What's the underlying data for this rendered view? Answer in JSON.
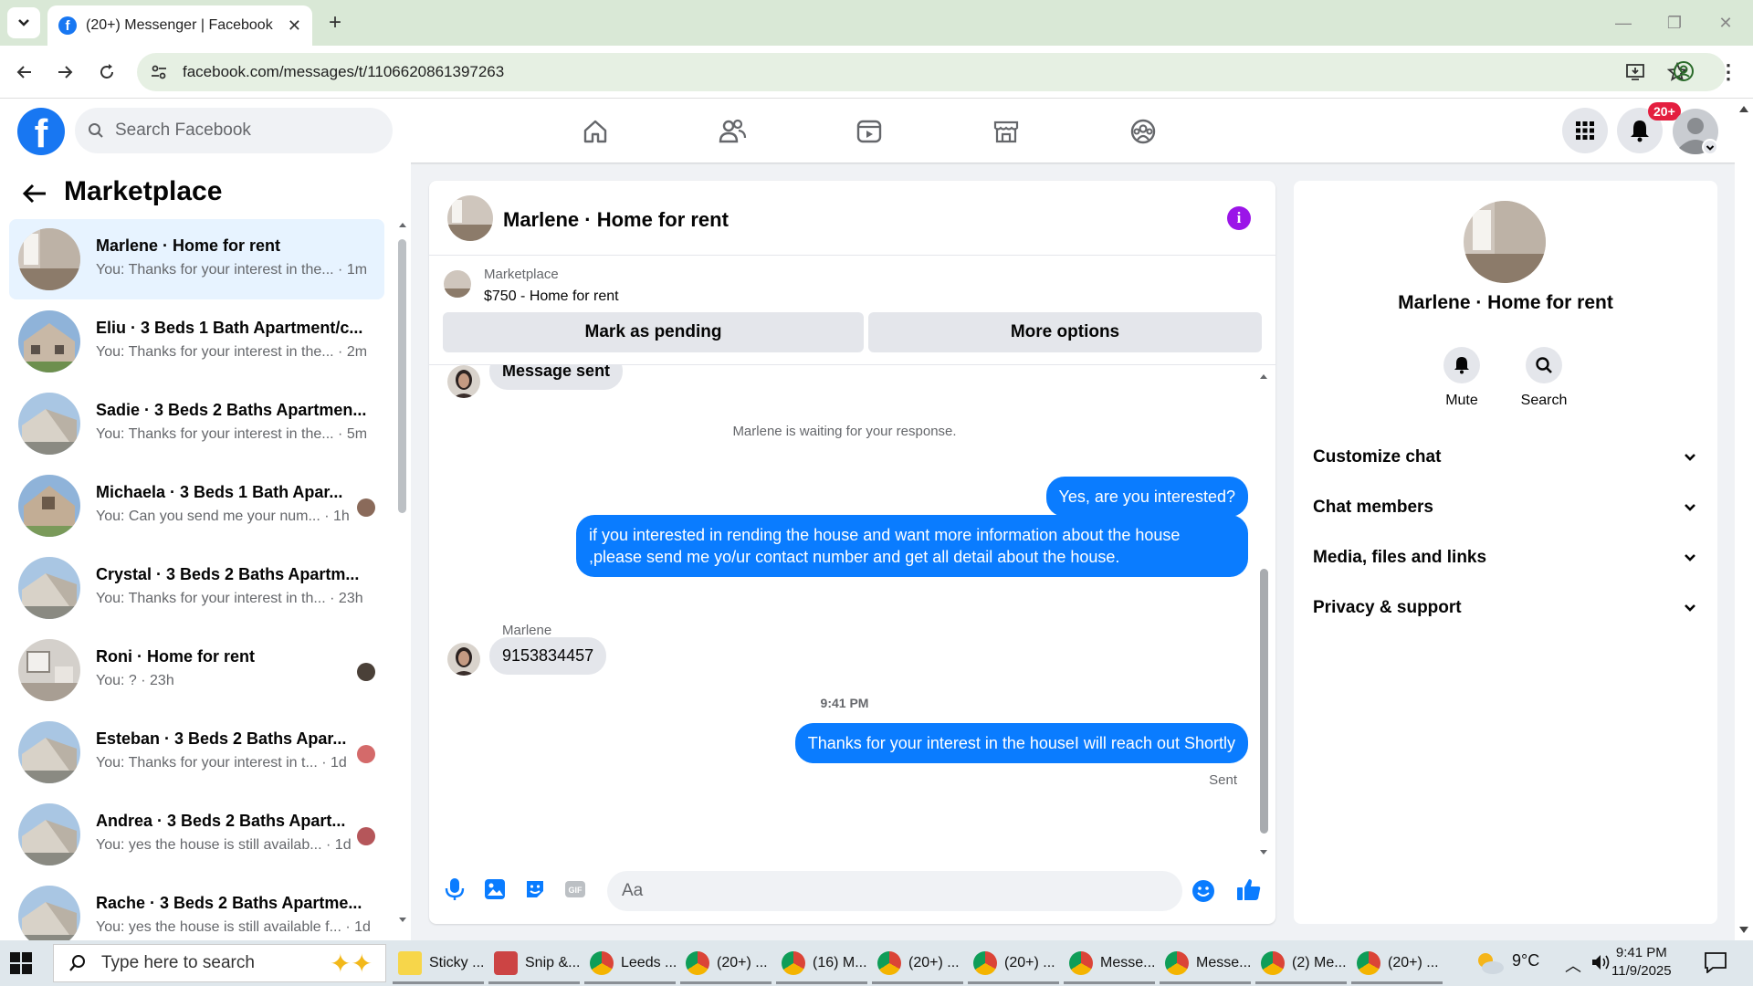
{
  "browser": {
    "tab_title": "(20+) Messenger | Facebook",
    "url": "facebook.com/messages/t/1106620861397263"
  },
  "header": {
    "search_placeholder": "Search Facebook",
    "notification_badge": "20+"
  },
  "left": {
    "title": "Marketplace",
    "conversations": [
      {
        "name": "Marlene · Home for rent",
        "preview": "You: Thanks for your interest in the...",
        "time": "· 1m"
      },
      {
        "name": "Eliu · 3 Beds 1 Bath Apartment/c...",
        "preview": "You: Thanks for your interest in the...",
        "time": "· 2m"
      },
      {
        "name": "Sadie · 3 Beds 2 Baths Apartmen...",
        "preview": "You: Thanks for your interest in the...",
        "time": "· 5m"
      },
      {
        "name": "Michaela · 3 Beds 1 Bath Apar...",
        "preview": "You: Can you send me your num...",
        "time": "· 1h"
      },
      {
        "name": "Crystal · 3 Beds 2 Baths Apartm...",
        "preview": "You: Thanks for your interest in th...",
        "time": "· 23h"
      },
      {
        "name": "Roni · Home for rent",
        "preview": "You: ?",
        "time": "· 23h"
      },
      {
        "name": "Esteban · 3 Beds 2 Baths Apar...",
        "preview": "You: Thanks for your interest in t...",
        "time": "· 1d"
      },
      {
        "name": "Andrea · 3 Beds 2 Baths Apart...",
        "preview": "You: yes the house is still availab...",
        "time": "· 1d"
      },
      {
        "name": "Rache · 3 Beds 2 Baths Apartme...",
        "preview": "You: yes the house is still available f...",
        "time": "· 1d"
      }
    ]
  },
  "chat": {
    "title": "Marlene · Home for rent",
    "marketplace_label": "Marketplace",
    "listing": "$750 - Home for rent",
    "btn_pending": "Mark as pending",
    "btn_more": "More options",
    "msg_sent": "Message sent",
    "waiting": "Marlene is waiting for your response.",
    "out1": "Yes, are you interested?",
    "out2": "if you interested in rending the house and want more information about the house ,please send me yo/ur contact number and get all detail about the house.",
    "sender": "Marlene",
    "in1": "9153834457",
    "timestamp": "9:41 PM",
    "out3": "Thanks for your interest in the houseI will reach out Shortly",
    "status": "Sent",
    "composer_placeholder": "Aa"
  },
  "right": {
    "name": "Marlene · Home for rent",
    "mute": "Mute",
    "search": "Search",
    "rows": [
      "Customize chat",
      "Chat members",
      "Media, files and links",
      "Privacy & support"
    ]
  },
  "taskbar": {
    "search": "Type here to search",
    "apps": [
      "Sticky ...",
      "Snip &...",
      "Leeds ...",
      "(20+) ...",
      "(16) M...",
      "(20+) ...",
      "(20+) ...",
      "Messe...",
      "Messe...",
      "(2) Me...",
      "(20+) ..."
    ],
    "temp": "9°C",
    "time": "9:41 PM",
    "date": "11/9/2025"
  },
  "colors": {
    "fb_blue": "#1877f2",
    "messenger_blue": "#0a7cff",
    "active_row": "#e7f3ff",
    "info_purple": "#9b15e8"
  }
}
